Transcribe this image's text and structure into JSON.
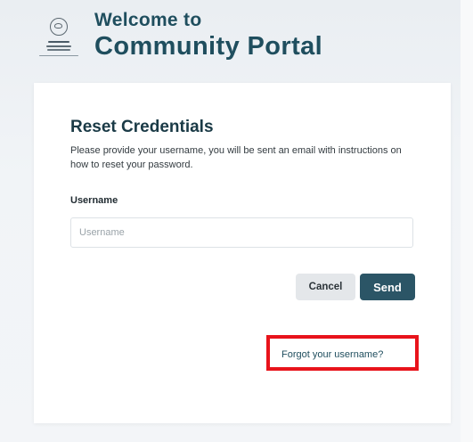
{
  "header": {
    "title_line1": "Welcome to",
    "title_line2": "Community Portal",
    "title_color": "#1f4e5e"
  },
  "logo": {
    "icon": "government-crest-icon"
  },
  "card": {
    "title": "Reset Credentials",
    "description": "Please provide your username, you will be sent an email with instructions on how to reset your password.",
    "username_label": "Username",
    "username_placeholder": "Username",
    "username_value": "",
    "cancel_label": "Cancel",
    "send_label": "Send",
    "forgot_link_label": "Forgot your username?"
  },
  "colors": {
    "primary_button": "#2b5566",
    "secondary_button": "#e4e7ea",
    "highlight_box": "#e8131b"
  }
}
